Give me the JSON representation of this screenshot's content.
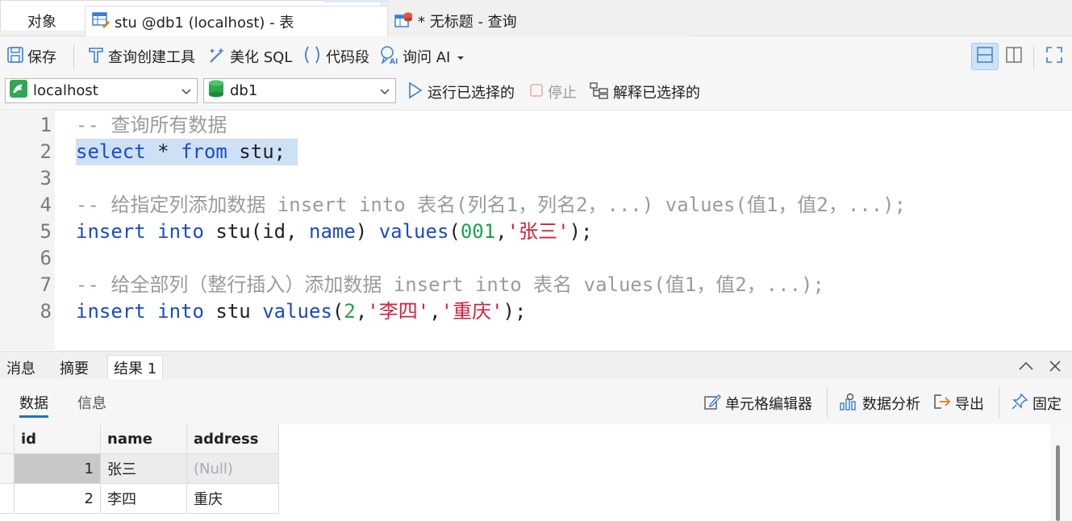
{
  "tabs": {
    "objects": "对象",
    "table_tab": "stu @db1 (localhost) - 表",
    "query_tab": "* 无标题 - 查询"
  },
  "toolbar": {
    "save": "保存",
    "query_builder": "查询创建工具",
    "beautify": "美化 SQL",
    "snippet": "代码段",
    "ask_ai": "询问 AI"
  },
  "connection": {
    "server": "localhost",
    "database": "db1",
    "run_selected": "运行已选择的",
    "stop": "停止",
    "explain_selected": "解释已选择的"
  },
  "editor": {
    "lines": [
      {
        "n": "1",
        "tokens": [
          {
            "t": "-- 查询所有数据",
            "c": "cm"
          }
        ]
      },
      {
        "n": "2",
        "tokens": [
          {
            "t": "select",
            "c": "kw"
          },
          {
            "t": " * ",
            "c": ""
          },
          {
            "t": "from",
            "c": "kw"
          },
          {
            "t": " stu; ",
            "c": ""
          }
        ],
        "selected": true
      },
      {
        "n": "3",
        "tokens": []
      },
      {
        "n": "4",
        "tokens": [
          {
            "t": "-- 给指定列添加数据 insert into 表名(列名1，列名2，...) values(值1，值2，...);",
            "c": "cm"
          }
        ]
      },
      {
        "n": "5",
        "tokens": [
          {
            "t": "insert",
            "c": "kw"
          },
          {
            "t": " ",
            "c": ""
          },
          {
            "t": "into",
            "c": "kw"
          },
          {
            "t": " stu(id, ",
            "c": ""
          },
          {
            "t": "name",
            "c": "kw"
          },
          {
            "t": ") ",
            "c": ""
          },
          {
            "t": "values",
            "c": "fn"
          },
          {
            "t": "(",
            "c": ""
          },
          {
            "t": "001",
            "c": "num"
          },
          {
            "t": ",",
            "c": ""
          },
          {
            "t": "'张三'",
            "c": "str"
          },
          {
            "t": ");",
            "c": ""
          }
        ]
      },
      {
        "n": "6",
        "tokens": []
      },
      {
        "n": "7",
        "tokens": [
          {
            "t": "-- 给全部列（整行插入）添加数据 insert into 表名 values(值1，值2，...);",
            "c": "cm"
          }
        ]
      },
      {
        "n": "8",
        "tokens": [
          {
            "t": "insert",
            "c": "kw"
          },
          {
            "t": " ",
            "c": ""
          },
          {
            "t": "into",
            "c": "kw"
          },
          {
            "t": " stu ",
            "c": ""
          },
          {
            "t": "values",
            "c": "fn"
          },
          {
            "t": "(",
            "c": ""
          },
          {
            "t": "2",
            "c": "num"
          },
          {
            "t": ",",
            "c": ""
          },
          {
            "t": "'李四'",
            "c": "str"
          },
          {
            "t": ",",
            "c": ""
          },
          {
            "t": "'重庆'",
            "c": "str"
          },
          {
            "t": ");",
            "c": ""
          }
        ]
      }
    ]
  },
  "bottom": {
    "tab_messages": "消息",
    "tab_summary": "摘要",
    "tab_result": "结果 1",
    "sub_data": "数据",
    "sub_info": "信息",
    "cell_editor": "单元格编辑器",
    "data_analysis": "数据分析",
    "export": "导出",
    "pin": "固定"
  },
  "grid": {
    "columns": [
      "id",
      "name",
      "address"
    ],
    "rows": [
      [
        "1",
        "张三",
        "(Null)"
      ],
      [
        "2",
        "李四",
        "重庆"
      ]
    ]
  },
  "colors": {
    "accent": "#1a73c9",
    "keyword": "#1b4ac7",
    "string": "#d6213c",
    "number": "#1aa34a",
    "comment": "#9b9b9b",
    "selection": "#cde0f5"
  }
}
